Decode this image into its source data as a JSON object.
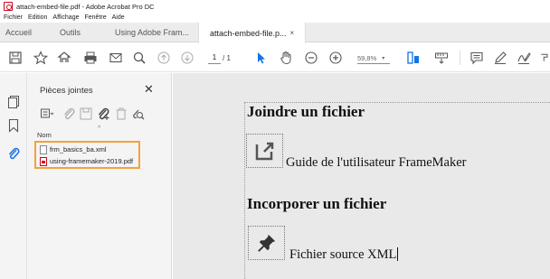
{
  "window": {
    "title": "attach-embed-file.pdf - Adobe Acrobat Pro DC",
    "app_icon": "acrobat-icon"
  },
  "menu": [
    "Fichier",
    "Edition",
    "Affichage",
    "Fenêtre",
    "Aide"
  ],
  "tabs": [
    {
      "label": "Accueil"
    },
    {
      "label": "Outils"
    },
    {
      "label": "Using Adobe Fram..."
    },
    {
      "label": "attach-embed-file.p...",
      "close": "×"
    }
  ],
  "toolbar": {
    "page_current": "1",
    "page_total": "/ 1",
    "zoom": "59,8%",
    "icons": [
      "save-icon",
      "bookmark-star-icon",
      "share-icon",
      "print-icon",
      "email-icon",
      "search-zoom-icon",
      "page-up-icon",
      "page-down-icon",
      "select-cursor-icon",
      "hand-icon",
      "zoom-out-icon",
      "zoom-in-icon",
      "fit-page-icon",
      "measure-icon",
      "comment-icon",
      "pen-icon",
      "sign-icon",
      "more-icon"
    ]
  },
  "panel": {
    "title": "Pièces jointes",
    "close": "✕",
    "column_header": "Nom",
    "attachments": [
      {
        "name": "frm_basics_ba.xml",
        "type": "xml"
      },
      {
        "name": "using-framemaker-2019.pdf",
        "type": "pdf"
      }
    ],
    "accent_color": "#f2a23b"
  },
  "document": {
    "heading1": "Joindre un fichier",
    "link1": "Guide de l'utilisateur FrameMaker",
    "heading2": "Incorporer un fichier",
    "link2": "Fichier source XML"
  }
}
